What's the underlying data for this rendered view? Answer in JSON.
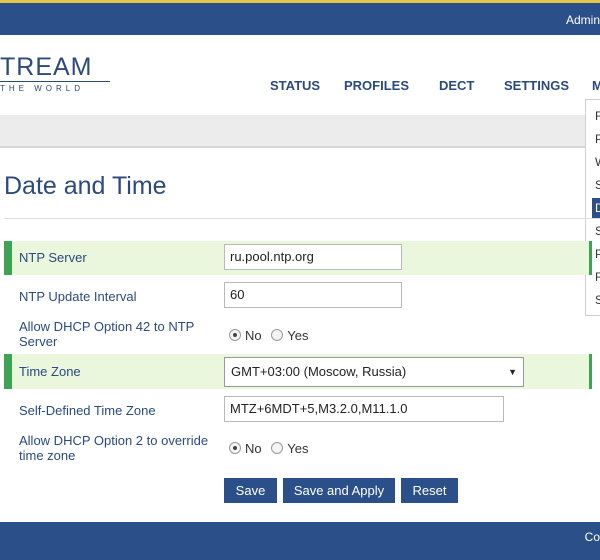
{
  "header": {
    "admin_label": "Admin"
  },
  "logo": {
    "main": "TREAM",
    "sub": "THE WORLD"
  },
  "nav": {
    "status": "STATUS",
    "profiles": "PROFILES",
    "dect": "DECT",
    "settings": "SETTINGS",
    "more": "M"
  },
  "dropdown": {
    "items": [
      "F",
      "P",
      "W",
      "S",
      "D",
      "S",
      "P",
      "F",
      "S"
    ],
    "selected_index": 4
  },
  "page": {
    "title": "Date and Time"
  },
  "form": {
    "ntp_server": {
      "label": "NTP Server",
      "value": "ru.pool.ntp.org"
    },
    "ntp_interval": {
      "label": "NTP Update Interval",
      "value": "60"
    },
    "dhcp42": {
      "label": "Allow DHCP Option 42 to NTP Server",
      "no": "No",
      "yes": "Yes",
      "selected": "No"
    },
    "time_zone": {
      "label": "Time Zone",
      "value": "GMT+03:00 (Moscow, Russia)"
    },
    "self_tz": {
      "label": "Self-Defined Time Zone",
      "value": "MTZ+6MDT+5,M3.2.0,M11.1.0"
    },
    "dhcp2": {
      "label": "Allow DHCP Option 2 to override time zone",
      "no": "No",
      "yes": "Yes",
      "selected": "No"
    }
  },
  "buttons": {
    "save": "Save",
    "save_apply": "Save and Apply",
    "reset": "Reset"
  },
  "footer": {
    "text": "Co"
  },
  "colors": {
    "primary": "#2b4f88",
    "highlight_bg": "#eaf7dc",
    "highlight_bar": "#3fa356",
    "accent_top": "#e6c64a"
  }
}
